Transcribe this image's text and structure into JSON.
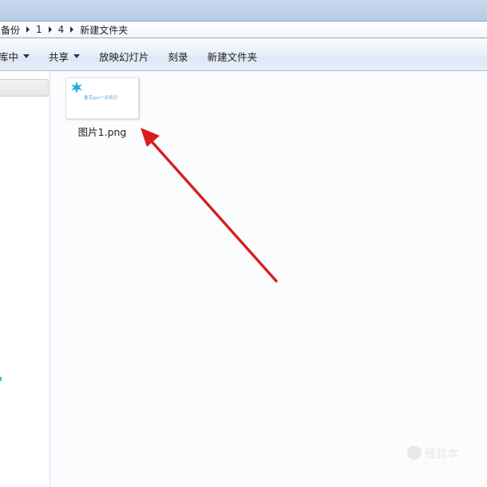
{
  "address_bar": {
    "breadcrumbs": [
      "备份",
      "1",
      "4",
      "新建文件夹"
    ]
  },
  "toolbar": {
    "include_in_library": "库中",
    "share": "共享",
    "slideshow": "放映幻灯片",
    "burn": "刻录",
    "new_folder": "新建文件夹"
  },
  "content": {
    "files": [
      {
        "name": "图片1.png",
        "thumbnail_text": "鲁克gui一点知识",
        "thumbnail_icon": "star-icon"
      }
    ]
  },
  "annotation": {
    "arrow_color": "#d81e1e",
    "arrow_icon": "red-arrow-icon"
  },
  "watermark": {
    "text": "经验本",
    "icon": "watermark-logo-icon"
  },
  "colors": {
    "toolbar_bg": "#e6eef8",
    "address_bg": "#b6cbe6",
    "content_bg": "#fbfcfd",
    "accent": "#1f3a5e"
  }
}
